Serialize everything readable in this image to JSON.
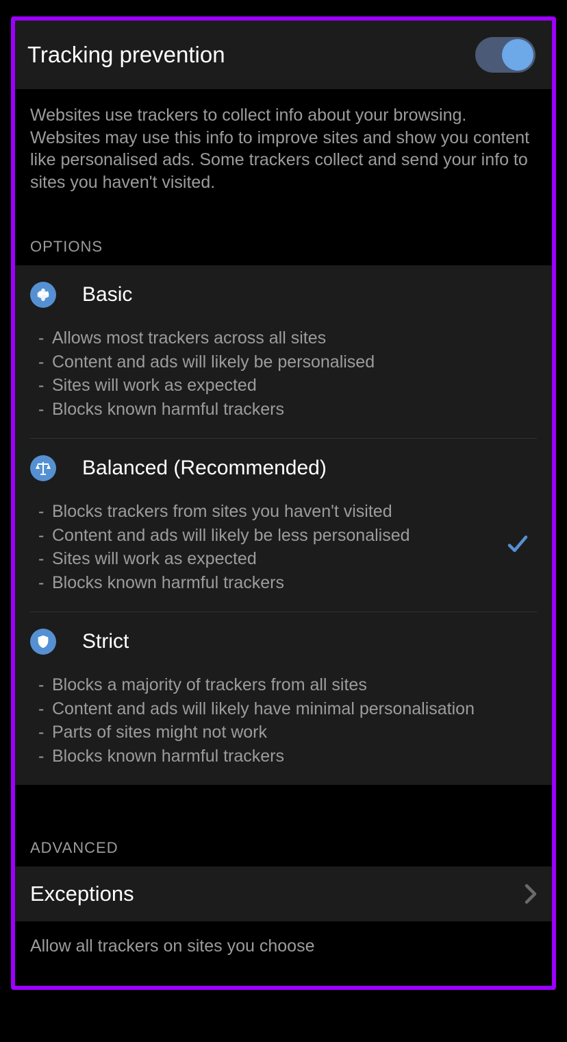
{
  "header": {
    "title": "Tracking prevention",
    "toggle_on": true
  },
  "description": "Websites use trackers to collect info about your browsing. Websites may use this info to improve sites and show you content like personalised ads. Some trackers collect and send your info to sites you haven't visited.",
  "options_label": "OPTIONS",
  "options": [
    {
      "title": "Basic",
      "icon": "megaphone",
      "selected": false,
      "bullets": [
        "Allows most trackers across all sites",
        "Content and ads will likely be personalised",
        "Sites will work as expected",
        "Blocks known harmful trackers"
      ]
    },
    {
      "title": "Balanced (Recommended)",
      "icon": "scales",
      "selected": true,
      "bullets": [
        "Blocks trackers from sites you haven't visited",
        "Content and ads will likely be less personalised",
        "Sites will work as expected",
        "Blocks known harmful trackers"
      ]
    },
    {
      "title": "Strict",
      "icon": "shield",
      "selected": false,
      "bullets": [
        "Blocks a majority of trackers from all sites",
        "Content and ads will likely have minimal personalisation",
        "Parts of sites might not work",
        "Blocks known harmful trackers"
      ]
    }
  ],
  "advanced_label": "ADVANCED",
  "exceptions": {
    "label": "Exceptions",
    "description": "Allow all trackers on sites you choose"
  }
}
